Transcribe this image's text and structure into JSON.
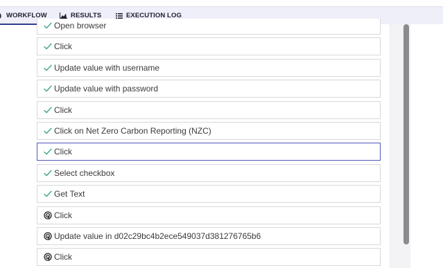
{
  "tabs": [
    {
      "label": "WORKFLOW",
      "icon": "workflow-icon",
      "active": true
    },
    {
      "label": "RESULTS",
      "icon": "chart-icon",
      "active": false
    },
    {
      "label": "EXECUTION LOG",
      "icon": "list-icon",
      "active": false
    }
  ],
  "colors": {
    "accent": "#2f3b8f",
    "success": "#3aa57a",
    "selected_border": "#5255b8",
    "tabbar_bg": "#eeeff8"
  },
  "steps": [
    {
      "label": "Open browser",
      "status": "done",
      "icon": "check-icon"
    },
    {
      "label": "Click",
      "status": "done",
      "icon": "check-icon"
    },
    {
      "label": "Update value with username",
      "status": "done",
      "icon": "check-icon"
    },
    {
      "label": "Update value with password",
      "status": "done",
      "icon": "check-icon"
    },
    {
      "label": "Click",
      "status": "done",
      "icon": "check-icon"
    },
    {
      "label": "Click on Net Zero Carbon Reporting (NZC)",
      "status": "done",
      "icon": "check-icon"
    },
    {
      "label": "Click",
      "status": "done",
      "icon": "check-icon",
      "selected": true
    },
    {
      "label": "Select checkbox",
      "status": "done",
      "icon": "check-icon"
    },
    {
      "label": "Get Text",
      "status": "done",
      "icon": "check-icon"
    },
    {
      "label": "Click",
      "status": "pending",
      "icon": "fingerprint-icon"
    },
    {
      "label": "Update value in d02c29bc4b2ece549037d381276765b6",
      "status": "pending",
      "icon": "fingerprint-icon"
    },
    {
      "label": "Click",
      "status": "pending",
      "icon": "fingerprint-icon"
    }
  ]
}
